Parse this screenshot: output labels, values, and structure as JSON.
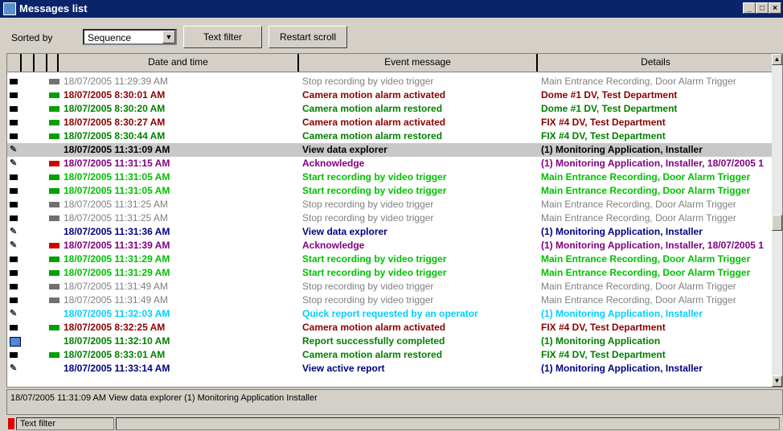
{
  "window": {
    "title": "Messages list"
  },
  "toolbar": {
    "sorted_by_label": "Sorted by",
    "sort_value": "Sequence",
    "text_filter_label": "Text filter",
    "restart_scroll_label": "Restart scroll"
  },
  "columns": [
    "Date and time",
    "Event message",
    "Details"
  ],
  "colors": {
    "gray": "#808080",
    "darkred": "#8b0000",
    "green": "#008000",
    "lime": "#00c000",
    "black": "#000000",
    "navy": "#000080",
    "purple": "#800080",
    "cyan": "#00d0ff",
    "red": "#c00000"
  },
  "rows": [
    {
      "icon": "camera-icon",
      "cam": "gray",
      "dt": "18/07/2005 11:29:39 AM",
      "ev": "Stop recording by video trigger",
      "det": "Main Entrance Recording, Door Alarm Trigger",
      "color": "gray",
      "bold": false
    },
    {
      "icon": "camera-icon",
      "cam": "green",
      "dt": "18/07/2005 8:30:01 AM",
      "ev": "Camera motion alarm activated",
      "det": "Dome #1 DV, Test Department",
      "color": "darkred",
      "bold": true
    },
    {
      "icon": "camera-icon",
      "cam": "green",
      "dt": "18/07/2005 8:30:20 AM",
      "ev": "Camera motion alarm restored",
      "det": "Dome #1 DV, Test Department",
      "color": "green",
      "bold": true
    },
    {
      "icon": "camera-icon",
      "cam": "green",
      "dt": "18/07/2005 8:30:27 AM",
      "ev": "Camera motion alarm activated",
      "det": "FIX #4 DV, Test Department",
      "color": "darkred",
      "bold": true
    },
    {
      "icon": "camera-icon",
      "cam": "green",
      "dt": "18/07/2005 8:30:44 AM",
      "ev": "Camera motion alarm restored",
      "det": "FIX #4 DV, Test Department",
      "color": "green",
      "bold": true
    },
    {
      "icon": "pen-icon",
      "cam": "",
      "dt": "18/07/2005 11:31:09 AM",
      "ev": "View data explorer",
      "det": "(1) Monitoring Application, Installer",
      "color": "black",
      "bold": true,
      "selected": true
    },
    {
      "icon": "pen-icon",
      "cam": "red",
      "dt": "18/07/2005 11:31:15 AM",
      "ev": "Acknowledge",
      "det": "(1) Monitoring Application, Installer, 18/07/2005 1",
      "color": "purple",
      "bold": true
    },
    {
      "icon": "camera-icon",
      "cam": "green",
      "dt": "18/07/2005 11:31:05 AM",
      "ev": "Start recording by video trigger",
      "det": "Main Entrance Recording, Door Alarm Trigger",
      "color": "lime",
      "bold": true
    },
    {
      "icon": "camera-icon",
      "cam": "green",
      "dt": "18/07/2005 11:31:05 AM",
      "ev": "Start recording by video trigger",
      "det": "Main Entrance Recording, Door Alarm Trigger",
      "color": "lime",
      "bold": true
    },
    {
      "icon": "camera-icon",
      "cam": "gray",
      "dt": "18/07/2005 11:31:25 AM",
      "ev": "Stop recording by video trigger",
      "det": "Main Entrance Recording, Door Alarm Trigger",
      "color": "gray",
      "bold": false
    },
    {
      "icon": "camera-icon",
      "cam": "gray",
      "dt": "18/07/2005 11:31:25 AM",
      "ev": "Stop recording by video trigger",
      "det": "Main Entrance Recording, Door Alarm Trigger",
      "color": "gray",
      "bold": false
    },
    {
      "icon": "pen-icon",
      "cam": "",
      "dt": "18/07/2005 11:31:36 AM",
      "ev": "View data explorer",
      "det": "(1) Monitoring Application, Installer",
      "color": "navy",
      "bold": true
    },
    {
      "icon": "pen-icon",
      "cam": "red",
      "dt": "18/07/2005 11:31:39 AM",
      "ev": "Acknowledge",
      "det": "(1) Monitoring Application, Installer, 18/07/2005 1",
      "color": "purple",
      "bold": true
    },
    {
      "icon": "camera-icon",
      "cam": "green",
      "dt": "18/07/2005 11:31:29 AM",
      "ev": "Start recording by video trigger",
      "det": "Main Entrance Recording, Door Alarm Trigger",
      "color": "lime",
      "bold": true
    },
    {
      "icon": "camera-icon",
      "cam": "green",
      "dt": "18/07/2005 11:31:29 AM",
      "ev": "Start recording by video trigger",
      "det": "Main Entrance Recording, Door Alarm Trigger",
      "color": "lime",
      "bold": true
    },
    {
      "icon": "camera-icon",
      "cam": "gray",
      "dt": "18/07/2005 11:31:49 AM",
      "ev": "Stop recording by video trigger",
      "det": "Main Entrance Recording, Door Alarm Trigger",
      "color": "gray",
      "bold": false
    },
    {
      "icon": "camera-icon",
      "cam": "gray",
      "dt": "18/07/2005 11:31:49 AM",
      "ev": "Stop recording by video trigger",
      "det": "Main Entrance Recording, Door Alarm Trigger",
      "color": "gray",
      "bold": false
    },
    {
      "icon": "pen-icon",
      "cam": "",
      "dt": "18/07/2005 11:32:03 AM",
      "ev": "Quick report requested by an operator",
      "det": "(1) Monitoring Application, Installer",
      "color": "cyan",
      "bold": true
    },
    {
      "icon": "camera-icon",
      "cam": "green",
      "dt": "18/07/2005 8:32:25 AM",
      "ev": "Camera motion alarm activated",
      "det": "FIX #4 DV, Test Department",
      "color": "darkred",
      "bold": true
    },
    {
      "icon": "report-icon",
      "cam": "",
      "dt": "18/07/2005 11:32:10 AM",
      "ev": "Report successfully completed",
      "det": "(1) Monitoring Application",
      "color": "green",
      "bold": true
    },
    {
      "icon": "camera-icon",
      "cam": "green",
      "dt": "18/07/2005 8:33:01 AM",
      "ev": "Camera motion alarm restored",
      "det": "FIX #4 DV, Test Department",
      "color": "green",
      "bold": true
    },
    {
      "icon": "pen-icon",
      "cam": "",
      "dt": "18/07/2005 11:33:14 AM",
      "ev": "View active report",
      "det": "(1) Monitoring Application, Installer",
      "color": "navy",
      "bold": true
    }
  ],
  "detail_text": "18/07/2005 11:31:09 AM  View data explorer  (1)  Monitoring Application  Installer",
  "status": {
    "panel1": "Text filter"
  }
}
